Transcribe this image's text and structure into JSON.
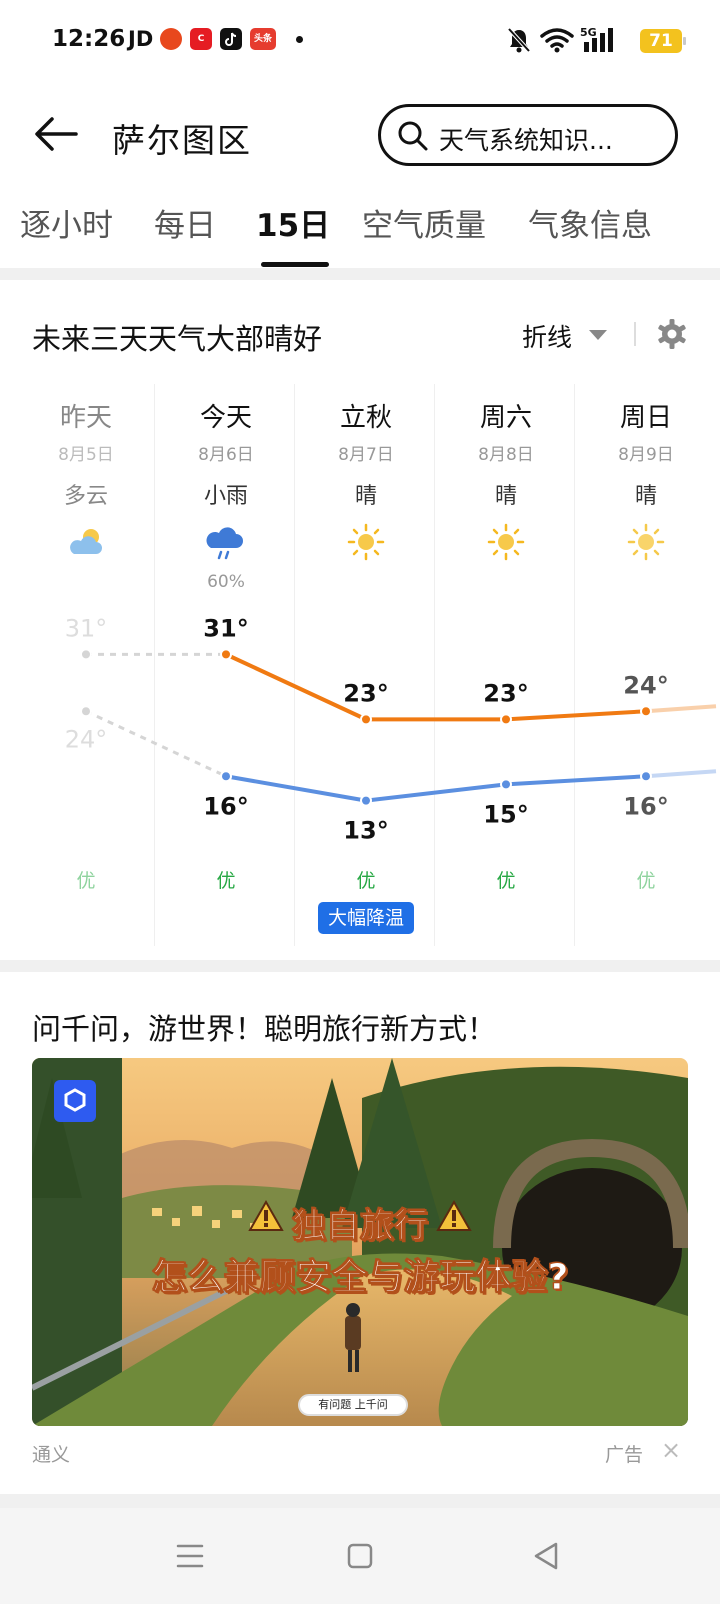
{
  "status_bar": {
    "time": "12:26",
    "carrier": "JD",
    "app_badges": [
      "C",
      "头条"
    ],
    "network": "5G",
    "battery": "71"
  },
  "header": {
    "title": "萨尔图区",
    "search_placeholder": "天气系统知识..."
  },
  "tabs": [
    {
      "label": "逐小时",
      "active": false
    },
    {
      "label": "每日",
      "active": false
    },
    {
      "label": "15日",
      "active": true
    },
    {
      "label": "空气质量",
      "active": false
    },
    {
      "label": "气象信息",
      "active": false
    }
  ],
  "forecast": {
    "summary": "未来三天天气大部晴好",
    "chart_mode": "折线",
    "days": [
      {
        "name": "昨天",
        "date": "8月5日",
        "condition": "多云",
        "icon": "partly-cloudy-icon",
        "precip": "",
        "high": "31°",
        "low": "24°",
        "aqi": "优",
        "past": true
      },
      {
        "name": "今天",
        "date": "8月6日",
        "condition": "小雨",
        "icon": "light-rain-icon",
        "precip": "60%",
        "high": "31°",
        "low": "16°",
        "aqi": "优",
        "past": false
      },
      {
        "name": "立秋",
        "date": "8月7日",
        "condition": "晴",
        "icon": "sunny-icon",
        "precip": "",
        "high": "23°",
        "low": "13°",
        "aqi": "优",
        "past": false,
        "badge": "大幅降温"
      },
      {
        "name": "周六",
        "date": "8月8日",
        "condition": "晴",
        "icon": "sunny-icon",
        "precip": "",
        "high": "23°",
        "low": "15°",
        "aqi": "优",
        "past": false
      },
      {
        "name": "周日",
        "date": "8月9日",
        "condition": "晴",
        "icon": "sunny-icon",
        "precip": "",
        "high": "24°",
        "low": "16°",
        "aqi": "优",
        "past": false
      }
    ],
    "colors": {
      "high_line": "#f07a12",
      "low_line": "#5b8fe0",
      "past_line": "#d5d5d5",
      "aqi_good": "#27a844"
    }
  },
  "chart_data": {
    "type": "line",
    "categories": [
      "昨天",
      "今天",
      "立秋",
      "周六",
      "周日"
    ],
    "series": [
      {
        "values": [
          31,
          31,
          23,
          23,
          24
        ]
      },
      {
        "values": [
          24,
          16,
          13,
          15,
          16
        ]
      }
    ],
    "ylim": [
      10,
      34
    ],
    "grid": false
  },
  "ad": {
    "title": "问千问，游世界！聪明旅行新方式！",
    "headline_1": "独自旅行",
    "headline_2": "怎么兼顾安全与游玩体验?",
    "cta": "有问题 上千问",
    "source": "通义",
    "label": "广告",
    "close": "×"
  }
}
